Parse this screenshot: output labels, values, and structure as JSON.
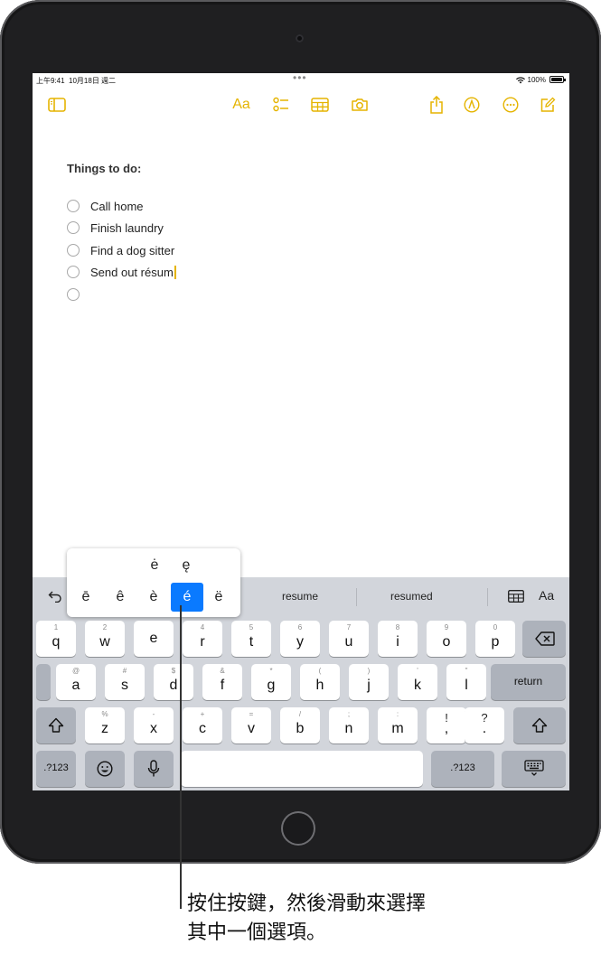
{
  "status_bar": {
    "time": "上午9:41",
    "date": "10月18日 週二",
    "dots": "•••",
    "battery": "100%"
  },
  "toolbar": {
    "sidebar_icon": "sidebar-icon",
    "format_label": "Aa",
    "checklist_icon": "checklist-icon",
    "table_icon": "table-icon",
    "camera_icon": "camera-icon",
    "share_icon": "share-icon",
    "markup_icon": "markup-icon",
    "more_icon": "ellipsis-circle-icon",
    "compose_icon": "compose-icon",
    "accent_color": "#e5b400"
  },
  "note": {
    "title": "Things to do:",
    "items": [
      "Call home",
      "Finish laundry",
      "Find a dog sitter",
      "Send out résum",
      ""
    ]
  },
  "keyboard": {
    "suggestions": [
      "resume",
      "resumed"
    ],
    "format_label": "Aa",
    "row1": [
      {
        "main": "q",
        "alt": "1"
      },
      {
        "main": "w",
        "alt": "2"
      },
      {
        "main": "e",
        "alt": ""
      },
      {
        "main": "r",
        "alt": "4"
      },
      {
        "main": "t",
        "alt": "5"
      },
      {
        "main": "y",
        "alt": "6"
      },
      {
        "main": "u",
        "alt": "7"
      },
      {
        "main": "i",
        "alt": "8"
      },
      {
        "main": "o",
        "alt": "9"
      },
      {
        "main": "p",
        "alt": "0"
      }
    ],
    "row2": [
      {
        "main": "a",
        "alt": "@"
      },
      {
        "main": "s",
        "alt": "#"
      },
      {
        "main": "d",
        "alt": "$"
      },
      {
        "main": "f",
        "alt": "&"
      },
      {
        "main": "g",
        "alt": "*"
      },
      {
        "main": "h",
        "alt": "("
      },
      {
        "main": "j",
        "alt": ")"
      },
      {
        "main": "k",
        "alt": "'"
      },
      {
        "main": "l",
        "alt": "\""
      }
    ],
    "row3": [
      {
        "main": "z",
        "alt": "%"
      },
      {
        "main": "x",
        "alt": "-"
      },
      {
        "main": "c",
        "alt": "+"
      },
      {
        "main": "v",
        "alt": "="
      },
      {
        "main": "b",
        "alt": "/"
      },
      {
        "main": "n",
        "alt": ";"
      },
      {
        "main": "m",
        "alt": ":"
      },
      {
        "main": ",",
        "alt": "!"
      },
      {
        "main": ".",
        "alt": "?"
      }
    ],
    "return_label": "return",
    "numbers_label": ".?123",
    "accent_popup": {
      "top_row": [
        "ė",
        "ę"
      ],
      "bottom_row": [
        "ē",
        "ê",
        "è",
        "é",
        "ë"
      ],
      "selected": "é",
      "selected_color": "#0a7aff"
    }
  },
  "caption": {
    "line1": "按住按鍵，然後滑動來選擇",
    "line2": "其中一個選項。"
  }
}
